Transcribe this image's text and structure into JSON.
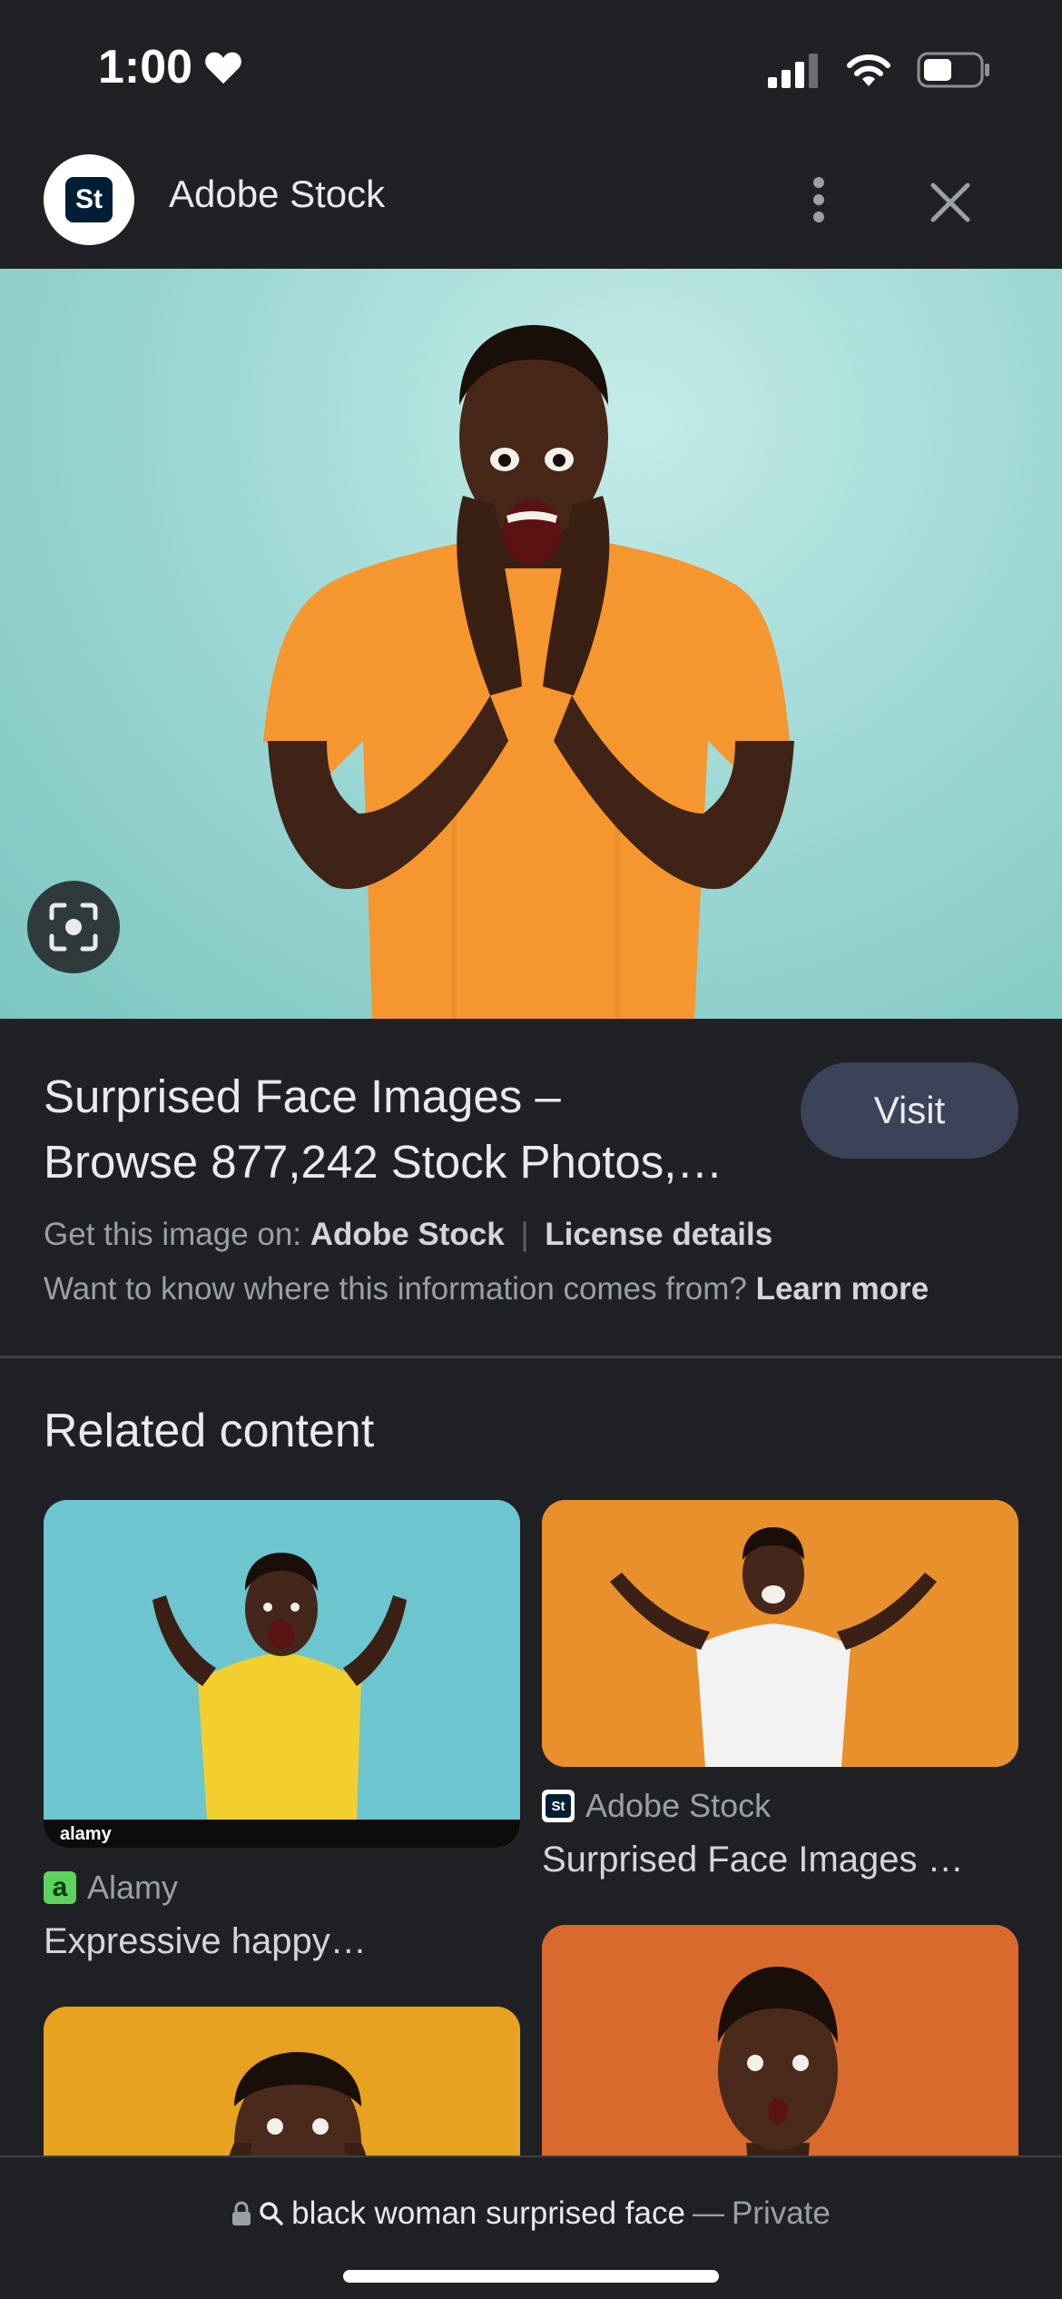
{
  "status_bar": {
    "time": "1:00"
  },
  "header": {
    "title": "Adobe Stock",
    "logo_text": "St"
  },
  "result": {
    "title_line1": "Surprised Face Images –",
    "title_line2": "Browse 877,242 Stock Photos,…",
    "visit_label": "Visit",
    "get_image_prefix": "Get this image on:",
    "get_image_source": "Adobe Stock",
    "separator": "|",
    "license_label": "License details",
    "where_info": "Want to know where this information comes from?",
    "learn_more": "Learn more"
  },
  "related": {
    "heading": "Related content",
    "cards": [
      {
        "source": "Alamy",
        "favicon_text": "a",
        "title": "Expressive happy…",
        "image_bg": "#6cc5cf"
      },
      {
        "source": "Adobe Stock",
        "favicon_text": "St",
        "title": "Surprised Face Images …",
        "image_bg": "#e8902c"
      },
      {
        "source": "",
        "title": "",
        "image_bg": "#e7a21f"
      },
      {
        "source": "",
        "title": "",
        "image_bg": "#d96a2e"
      }
    ],
    "watermark": "alamy"
  },
  "bottom_bar": {
    "query": "black woman surprised face",
    "dash": "—",
    "mode": "Private"
  },
  "colors": {
    "background": "#202124",
    "visit_button": "#3c4257",
    "hero_bg": "#9fd9d5",
    "shirt_orange": "#f5962f"
  }
}
